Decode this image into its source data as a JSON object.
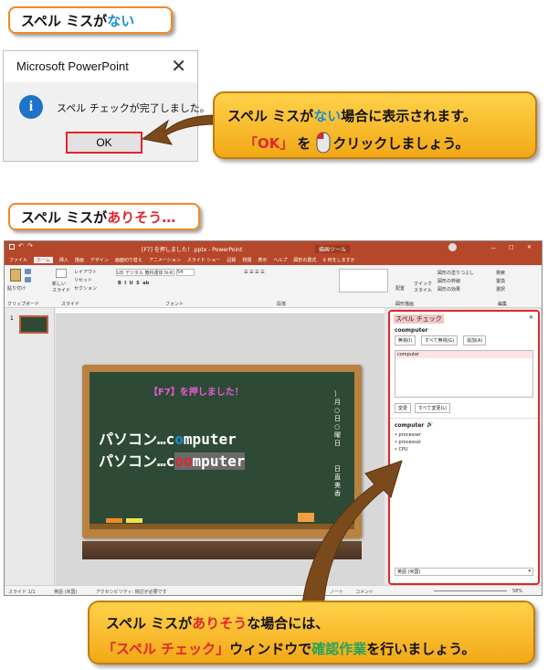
{
  "top_label": {
    "prefix": "スペル ミスが",
    "accent": "ない"
  },
  "dialog": {
    "title": "Microsoft PowerPoint",
    "close_glyph": "✕",
    "info_glyph": "i",
    "message": "スペル チェックが完了しました。",
    "ok_label": "OK"
  },
  "callout_top": {
    "line1_a": "スペル ミスが",
    "line1_accent": "ない",
    "line1_b": "場合に表示されます。",
    "line2_ok": "「OK」",
    "line2_a": "を",
    "line2_b": "クリックしましょう。"
  },
  "mid_label": {
    "prefix": "スペル ミスが",
    "accent": "ありそう…"
  },
  "ppt": {
    "title": "[F7] を押しました！.pptx - PowerPoint",
    "tool_tab": "描画ツール",
    "window_controls": [
      "ー",
      "□",
      "✕"
    ],
    "tabs": [
      "ファイル",
      "ホーム",
      "挿入",
      "描画",
      "デザイン",
      "画面切り替え",
      "アニメーション",
      "スライド ショー",
      "記録",
      "校閲",
      "表示",
      "ヘルプ",
      "図形の書式",
      "♀ 何をしますか"
    ],
    "ribbon": {
      "paste": "貼り付け",
      "clipboard": "クリップボード",
      "new_slide": "新しい\nスライド",
      "layout": "レイアウト",
      "reset": "リセット",
      "section": "セクション",
      "slides": "スライド",
      "font_name": "UD デジタル 教科書体 N-R",
      "font_size": "54",
      "font": "フォント",
      "paragraph": "段落",
      "drawing": "図形描画",
      "arrange": "配置",
      "quick_styles": "クイック\nスタイル",
      "shape_fill": "図形の塗りつぶし",
      "shape_outline": "図形の枠線",
      "shape_effects": "図形の効果",
      "find": "検索",
      "replace": "置換",
      "select": "選択",
      "editing": "編集"
    },
    "slide_number": "1",
    "slide": {
      "title": "【F7】を押しました！",
      "line1_prefix": "パソコン…c",
      "line1_o": "o",
      "line1_rest": "mputer",
      "line2_prefix": "パソコン…c",
      "line2_oo": "oo",
      "line2_rest": "mputer",
      "vertical_1": "〕月○日 ○曜日",
      "vertical_2": "日直 美香"
    },
    "spell_pane": {
      "title": "スペル チェック",
      "close": "✕",
      "word": "coomputer",
      "ignore": "無視(I)",
      "ignore_all": "すべて無視(G)",
      "add": "追加(A)",
      "suggestion_selected": "computer",
      "change": "変更",
      "change_all": "すべて変更(L)",
      "definition_word": "computer",
      "speaker": "🔊",
      "synonyms": [
        "processer",
        "processor",
        "CPU"
      ],
      "language": "英語 (米国)"
    },
    "status": {
      "slide": "スライド 1/1",
      "language": "英語 (米国)",
      "accessibility": "アクセシビリティ: 検討が必要です",
      "notes": "ノート",
      "comments": "コメント",
      "zoom": "58%"
    }
  },
  "callout_bottom": {
    "line1_a": "スペル ミスが",
    "line1_accent": "ありそう",
    "line1_b": "な場合には、",
    "line2_quote": "「スペル チェック」",
    "line2_a": "ウィンドウで",
    "line2_green": "確認作業",
    "line2_b": "を行いましょう。"
  },
  "colors": {
    "accent_blue": "#1a8fd1",
    "accent_red": "#e0262c",
    "callout_fill": "#f8c12e",
    "ppt_brand": "#b7472a"
  }
}
